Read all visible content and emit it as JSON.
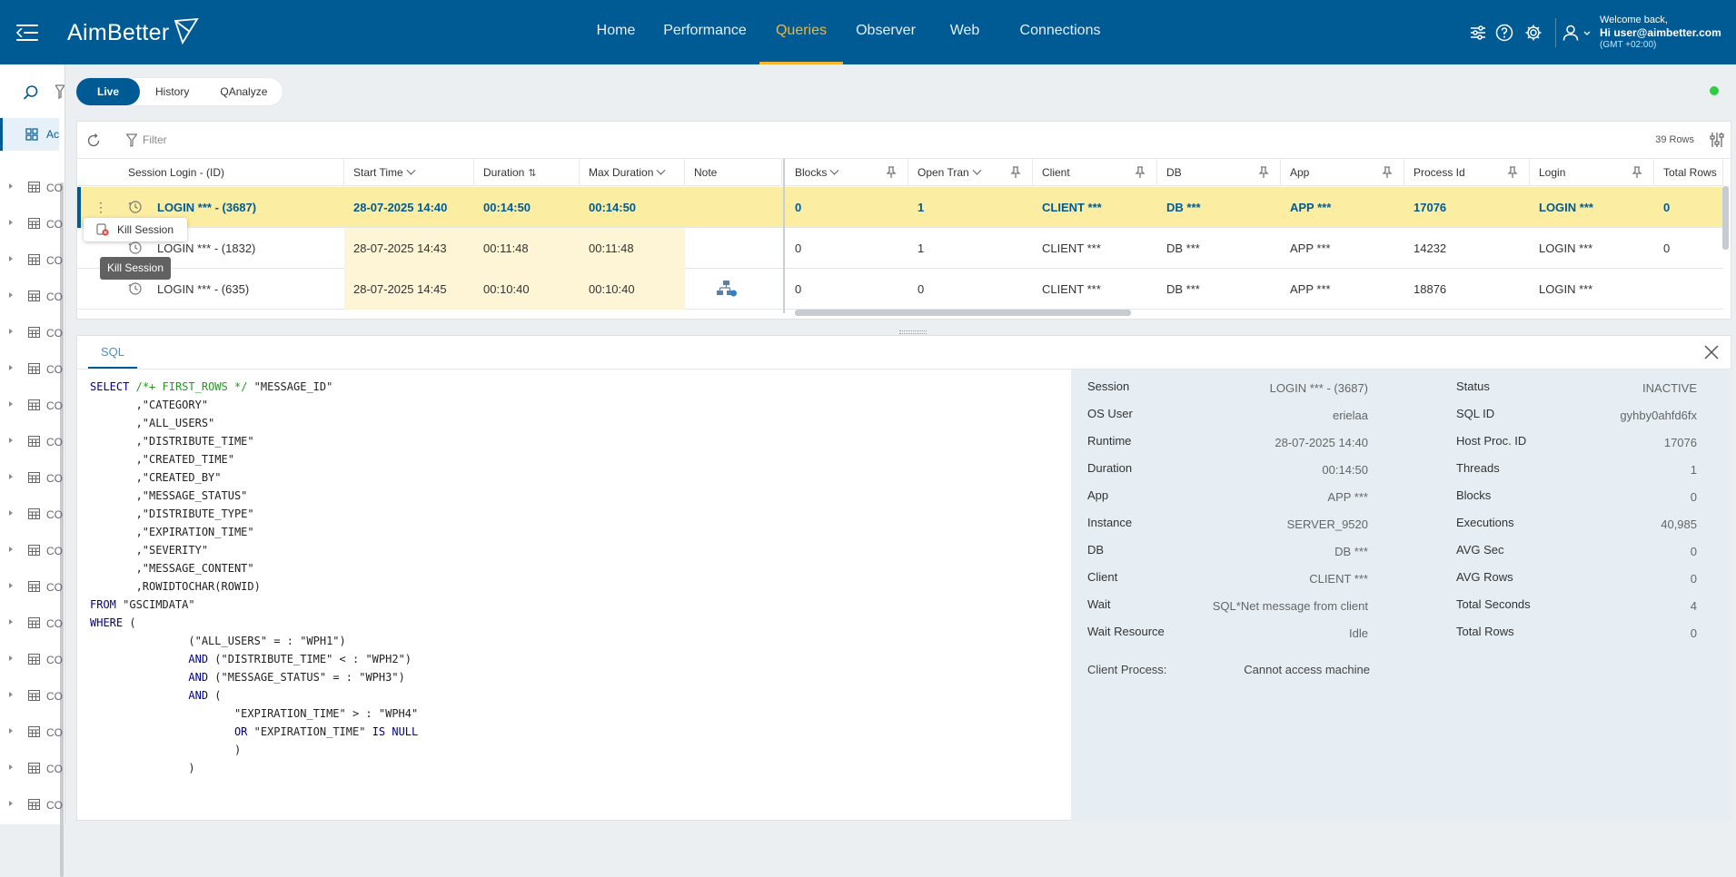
{
  "app": {
    "logo_text": "AimBetter",
    "nav": [
      "Home",
      "Performance",
      "Queries",
      "Observer",
      "Web",
      "Connections"
    ],
    "nav_active": "Queries",
    "user": {
      "welcome": "Welcome back,",
      "hi": "Hi user@aimbetter.com",
      "tz": "(GMT +02:00)"
    },
    "colors": {
      "brand": "#005b94",
      "active_nav": "#f4b634",
      "selected_row": "#fbeda2",
      "status_ok": "#2ecc40"
    }
  },
  "sidebar": {
    "active_label": "Ac",
    "row_label": "CO"
  },
  "tabs": [
    "Live",
    "History",
    "QAnalyze"
  ],
  "tabs_active": "Live",
  "grid": {
    "filter_placeholder": "Filter",
    "rows_count": "39 Rows",
    "columns": [
      "Session Login - (ID)",
      "Start Time",
      "Duration",
      "Max Duration",
      "Note",
      "Blocks",
      "Open Tran",
      "Client",
      "DB",
      "App",
      "Process Id",
      "Login",
      "Total Rows"
    ],
    "rows": [
      {
        "session": "LOGIN *** - (3687)",
        "start": "28-07-2025 14:40",
        "duration": "00:14:50",
        "max_duration": "00:14:50",
        "blocks": "0",
        "open_tran": "1",
        "client": "CLIENT ***",
        "db": "DB ***",
        "app": "APP ***",
        "process_id": "17076",
        "login": "LOGIN ***",
        "total_rows": "0"
      },
      {
        "session": "LOGIN *** - (1832)",
        "start": "28-07-2025 14:43",
        "duration": "00:11:48",
        "max_duration": "00:11:48",
        "blocks": "0",
        "open_tran": "1",
        "client": "CLIENT ***",
        "db": "DB ***",
        "app": "APP ***",
        "process_id": "14232",
        "login": "LOGIN ***",
        "total_rows": "0"
      },
      {
        "session": "LOGIN *** - (635)",
        "start": "28-07-2025 14:45",
        "duration": "00:10:40",
        "max_duration": "00:10:40",
        "blocks": "0",
        "open_tran": "0",
        "client": "CLIENT ***",
        "db": "DB ***",
        "app": "APP ***",
        "process_id": "18876",
        "login": "LOGIN ***",
        "total_rows": ""
      }
    ],
    "context_menu_item": "Kill Session",
    "tooltip": "Kill Session"
  },
  "sql_panel": {
    "tab": "SQL",
    "code": [
      [
        [
          "kw",
          "SELECT"
        ],
        [
          "t",
          " "
        ],
        [
          "cm",
          "/*+ FIRST_ROWS */"
        ],
        [
          "t",
          " \"MESSAGE_ID\""
        ]
      ],
      [
        [
          "t",
          "       ,\"CATEGORY\""
        ]
      ],
      [
        [
          "t",
          "       ,\"ALL_USERS\""
        ]
      ],
      [
        [
          "t",
          "       ,\"DISTRIBUTE_TIME\""
        ]
      ],
      [
        [
          "t",
          "       ,\"CREATED_TIME\""
        ]
      ],
      [
        [
          "t",
          "       ,\"CREATED_BY\""
        ]
      ],
      [
        [
          "t",
          "       ,\"MESSAGE_STATUS\""
        ]
      ],
      [
        [
          "t",
          "       ,\"DISTRIBUTE_TYPE\""
        ]
      ],
      [
        [
          "t",
          "       ,\"EXPIRATION_TIME\""
        ]
      ],
      [
        [
          "t",
          "       ,\"SEVERITY\""
        ]
      ],
      [
        [
          "t",
          "       ,\"MESSAGE_CONTENT\""
        ]
      ],
      [
        [
          "t",
          "       ,ROWIDTOCHAR(ROWID)"
        ]
      ],
      [
        [
          "kw",
          "FROM"
        ],
        [
          "t",
          " \"GSCIMDATA\""
        ]
      ],
      [
        [
          "kw",
          "WHERE"
        ],
        [
          "t",
          " ("
        ]
      ],
      [
        [
          "t",
          "               (\"ALL_USERS\" = : \"WPH1\")"
        ]
      ],
      [
        [
          "t",
          "               "
        ],
        [
          "kw",
          "AND"
        ],
        [
          "t",
          " (\"DISTRIBUTE_TIME\" < : \"WPH2\")"
        ]
      ],
      [
        [
          "t",
          "               "
        ],
        [
          "kw",
          "AND"
        ],
        [
          "t",
          " (\"MESSAGE_STATUS\" = : \"WPH3\")"
        ]
      ],
      [
        [
          "t",
          "               "
        ],
        [
          "kw",
          "AND"
        ],
        [
          "t",
          " ("
        ]
      ],
      [
        [
          "t",
          "                      \"EXPIRATION_TIME\" > : \"WPH4\""
        ]
      ],
      [
        [
          "t",
          "                      "
        ],
        [
          "kw",
          "OR"
        ],
        [
          "t",
          " \"EXPIRATION_TIME\" "
        ],
        [
          "kw",
          "IS NULL"
        ]
      ],
      [
        [
          "t",
          "                      )"
        ]
      ],
      [
        [
          "t",
          "               )"
        ]
      ]
    ],
    "details_left": [
      {
        "label": "Session",
        "value": "LOGIN *** - (3687)"
      },
      {
        "label": "OS User",
        "value": "erielaa"
      },
      {
        "label": "Runtime",
        "value": "28-07-2025 14:40"
      },
      {
        "label": "Duration",
        "value": "00:14:50"
      },
      {
        "label": "App",
        "value": "APP ***"
      },
      {
        "label": "Instance",
        "value": "SERVER_9520"
      },
      {
        "label": "DB",
        "value": "DB ***"
      },
      {
        "label": "Client",
        "value": "CLIENT ***"
      },
      {
        "label": "Wait",
        "value": "SQL*Net message from client"
      },
      {
        "label": "Wait Resource",
        "value": "Idle"
      }
    ],
    "details_right": [
      {
        "label": "Status",
        "value": "INACTIVE"
      },
      {
        "label": "SQL ID",
        "value": "gyhby0ahfd6fx"
      },
      {
        "label": "Host Proc. ID",
        "value": "17076"
      },
      {
        "label": "Threads",
        "value": "1"
      },
      {
        "label": "Blocks",
        "value": "0"
      },
      {
        "label": "Executions",
        "value": "40,985"
      },
      {
        "label": "AVG Sec",
        "value": "0"
      },
      {
        "label": "AVG Rows",
        "value": "0"
      },
      {
        "label": "Total Seconds",
        "value": "4"
      },
      {
        "label": "Total Rows",
        "value": "0"
      }
    ],
    "client_process": {
      "label": "Client Process:",
      "value": "Cannot access machine"
    }
  }
}
